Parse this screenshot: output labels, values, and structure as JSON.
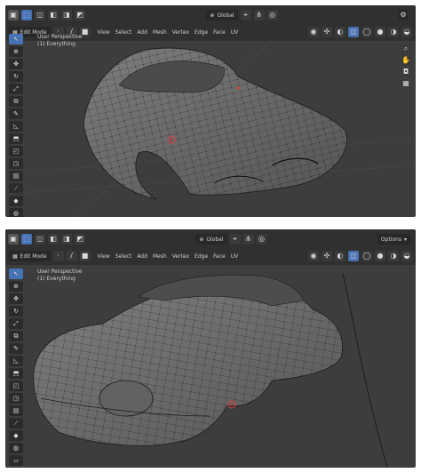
{
  "panels": [
    {
      "mode": "Edit Mode",
      "transform": "Global",
      "menu": [
        "View",
        "Select",
        "Add",
        "Mesh",
        "Vertex",
        "Edge",
        "Face",
        "UV"
      ],
      "overlay": [
        "User Perspective",
        "(1) Everything"
      ],
      "options": "Options"
    },
    {
      "mode": "Edit Mode",
      "transform": "Global",
      "menu": [
        "View",
        "Select",
        "Add",
        "Mesh",
        "Vertex",
        "Edge",
        "Face",
        "UV"
      ],
      "overlay": [
        "User Perspective",
        "(1) Everything"
      ],
      "options": "Options"
    }
  ],
  "icons": {
    "select_tool": "arrow-cursor-icon",
    "cursor_tool": "target-icon",
    "move_tool": "move-icon",
    "rotate_tool": "rotate-icon",
    "scale_tool": "scale-icon",
    "annotate_tool": "pencil-icon",
    "measure_tool": "ruler-icon"
  },
  "colors": {
    "viewport_bg": "#3d3d3d",
    "header_bg": "#303030",
    "accent": "#4772b3",
    "mesh": "#6a6a6a",
    "wire": "#1a1a1a",
    "cursor": "#e04040"
  }
}
